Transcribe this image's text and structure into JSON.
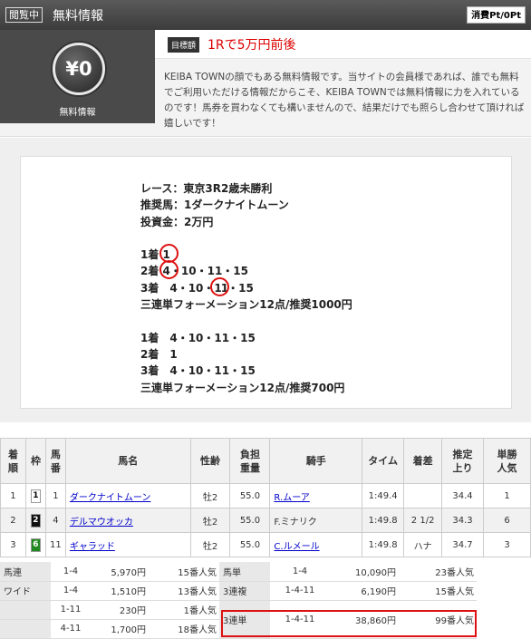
{
  "header": {
    "badge": "閲覧中",
    "title": "無料情報",
    "points": "消費Pt/0Pt"
  },
  "info": {
    "coin_value": "¥0",
    "coin_label": "無料情報",
    "goal_tag": "目標額",
    "goal_text": "1Rで5万円前後",
    "description": "KEIBA TOWNの顔でもある無料情報です。当サイトの会員様であれば、誰でも無料でご利用いただける情報だからこそ、KEIBA TOWNでは無料情報に力を入れているのです！馬券を買わなくても構いませんので、結果だけでも照らし合わせて頂ければ嬉しいです！"
  },
  "prediction": {
    "race": "レース：東京3R2歳未勝利",
    "horse": "推奨馬：1ダークナイトムーン",
    "stake": "投資金：2万円",
    "f1_label": "1着 ",
    "f1_num": "1",
    "f2_label": "2着 ",
    "f2_num": "4",
    "f2_rest": "・10・11・15",
    "f3_a": "3着　4・10・",
    "f3_num": "11",
    "f3_b": "・15",
    "formation1": "三連単フォーメーション12点/推奨1000円",
    "g1": "1着　4・10・11・15",
    "g2": "2着　1",
    "g3": "3着　4・10・11・15",
    "formation2": "三連単フォーメーション12点/推奨700円"
  },
  "results": {
    "headers": [
      "着\n順",
      "枠",
      "馬\n番",
      "馬名",
      "性齢",
      "負担\n重量",
      "騎手",
      "タイム",
      "着差",
      "推定\n上り",
      "単勝\n人気"
    ],
    "rows": [
      {
        "pos": "1",
        "waku": "1",
        "num": "1",
        "name": "ダークナイトムーン",
        "sex": "牡2",
        "weight": "55.0",
        "jockey": "R.ムーア",
        "time": "1:49.4",
        "margin": "",
        "agari": "34.4",
        "pop": "1"
      },
      {
        "pos": "2",
        "waku": "2",
        "num": "4",
        "name": "デルマウオッカ",
        "sex": "牡2",
        "weight": "55.0",
        "jockey": "F.ミナリク",
        "time": "1:49.8",
        "margin": "2 1/2",
        "agari": "34.3",
        "pop": "6"
      },
      {
        "pos": "3",
        "waku": "6",
        "num": "11",
        "name": "ギャラッド",
        "sex": "牡2",
        "weight": "55.0",
        "jockey": "C.ルメール",
        "time": "1:49.8",
        "margin": "ハナ",
        "agari": "34.7",
        "pop": "3"
      }
    ]
  },
  "payout": {
    "umaren": {
      "label": "馬連",
      "combo": "1-4",
      "amount": "5,970円",
      "pop": "15番人気"
    },
    "wide": {
      "label": "ワイド",
      "combos": [
        "1-4",
        "1-11",
        "4-11"
      ],
      "amounts": [
        "1,510円",
        "230円",
        "1,700円"
      ],
      "pops": [
        "13番人気",
        "1番人気",
        "18番人気"
      ]
    },
    "umatan": {
      "label": "馬単",
      "combo": "1-4",
      "amount": "10,090円",
      "pop": "23番人気"
    },
    "sanrenpuku": {
      "label": "3連複",
      "combo": "1-4-11",
      "amount": "6,190円",
      "pop": "15番人気"
    },
    "sanrentan": {
      "label": "3連単",
      "combo": "1-4-11",
      "amount": "38,860円",
      "pop": "99番人気"
    }
  },
  "colors": {
    "waku1": "#ffffff",
    "waku2": "#111111",
    "waku6": "#1f8a1f",
    "accent_red": "#dd1111"
  }
}
